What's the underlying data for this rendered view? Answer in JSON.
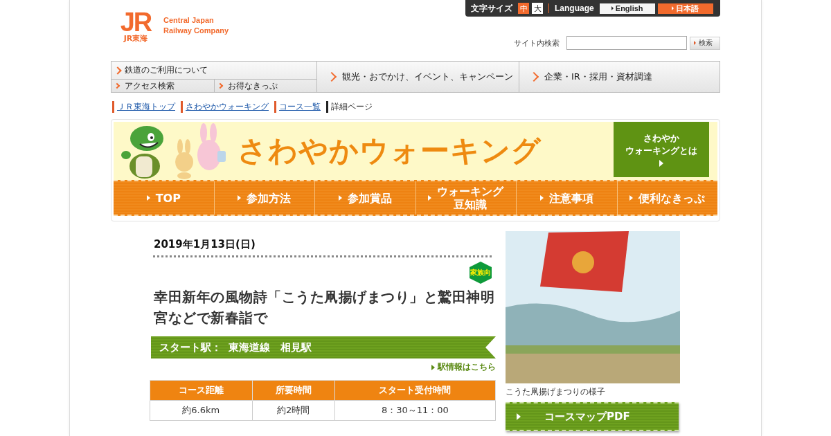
{
  "header": {
    "logo": {
      "mark": "JR",
      "sub": "JR東海",
      "name_lines": [
        "Central Japan",
        "Railway Company"
      ]
    },
    "font_size": {
      "label": "文字サイズ",
      "options": [
        {
          "label": "中",
          "selected": true
        },
        {
          "label": "大",
          "selected": false
        }
      ]
    },
    "language": {
      "label": "Language",
      "options": [
        {
          "label": "English",
          "selected": false
        },
        {
          "label": "日本語",
          "selected": true
        }
      ]
    },
    "search": {
      "label": "サイト内検索",
      "button": "検索"
    }
  },
  "global_nav": {
    "main": {
      "label": "鉄道のご利用について",
      "children": [
        "アクセス検索",
        "お得なきっぷ"
      ]
    },
    "items": [
      "観光・おでかけ、イベント、キャンペーン",
      "企業・IR・採用・資材調達"
    ]
  },
  "breadcrumb": [
    {
      "label": "ＪＲ東海トップ",
      "kind": "link"
    },
    {
      "label": "さわやかウォーキング",
      "kind": "link"
    },
    {
      "label": "コース一覧",
      "kind": "link"
    },
    {
      "label": "詳細ページ",
      "kind": "current"
    }
  ],
  "banner": {
    "title": "さわやかウォーキング",
    "about_lines": [
      "さわやか",
      "ウォーキングとは"
    ]
  },
  "banner_nav": [
    {
      "lines": [
        "TOP"
      ]
    },
    {
      "lines": [
        "参加方法"
      ]
    },
    {
      "lines": [
        "参加賞品"
      ]
    },
    {
      "lines": [
        "ウォーキング",
        "豆知識"
      ]
    },
    {
      "lines": [
        "注意事項"
      ]
    },
    {
      "lines": [
        "便利なきっぷ"
      ]
    }
  ],
  "event": {
    "date": "2019年1月13日(日)",
    "badge": "家族向",
    "title": "幸田新年の風物詩「こうた凧揚げまつり」と鷲田神明宮などで新春詣で",
    "start_station": "スタート駅：  東海道線　相見駅",
    "station_link": "駅情報はこちら",
    "table": {
      "columns": [
        "コース距離",
        "所要時間",
        "スタート受付時間"
      ],
      "rows": [
        [
          "約6.6km",
          "約2時間",
          "8：30～11：00"
        ]
      ]
    }
  },
  "photo": {
    "caption": "こうた凧揚げまつりの様子"
  },
  "pdf_button": "コースマップPDF"
}
